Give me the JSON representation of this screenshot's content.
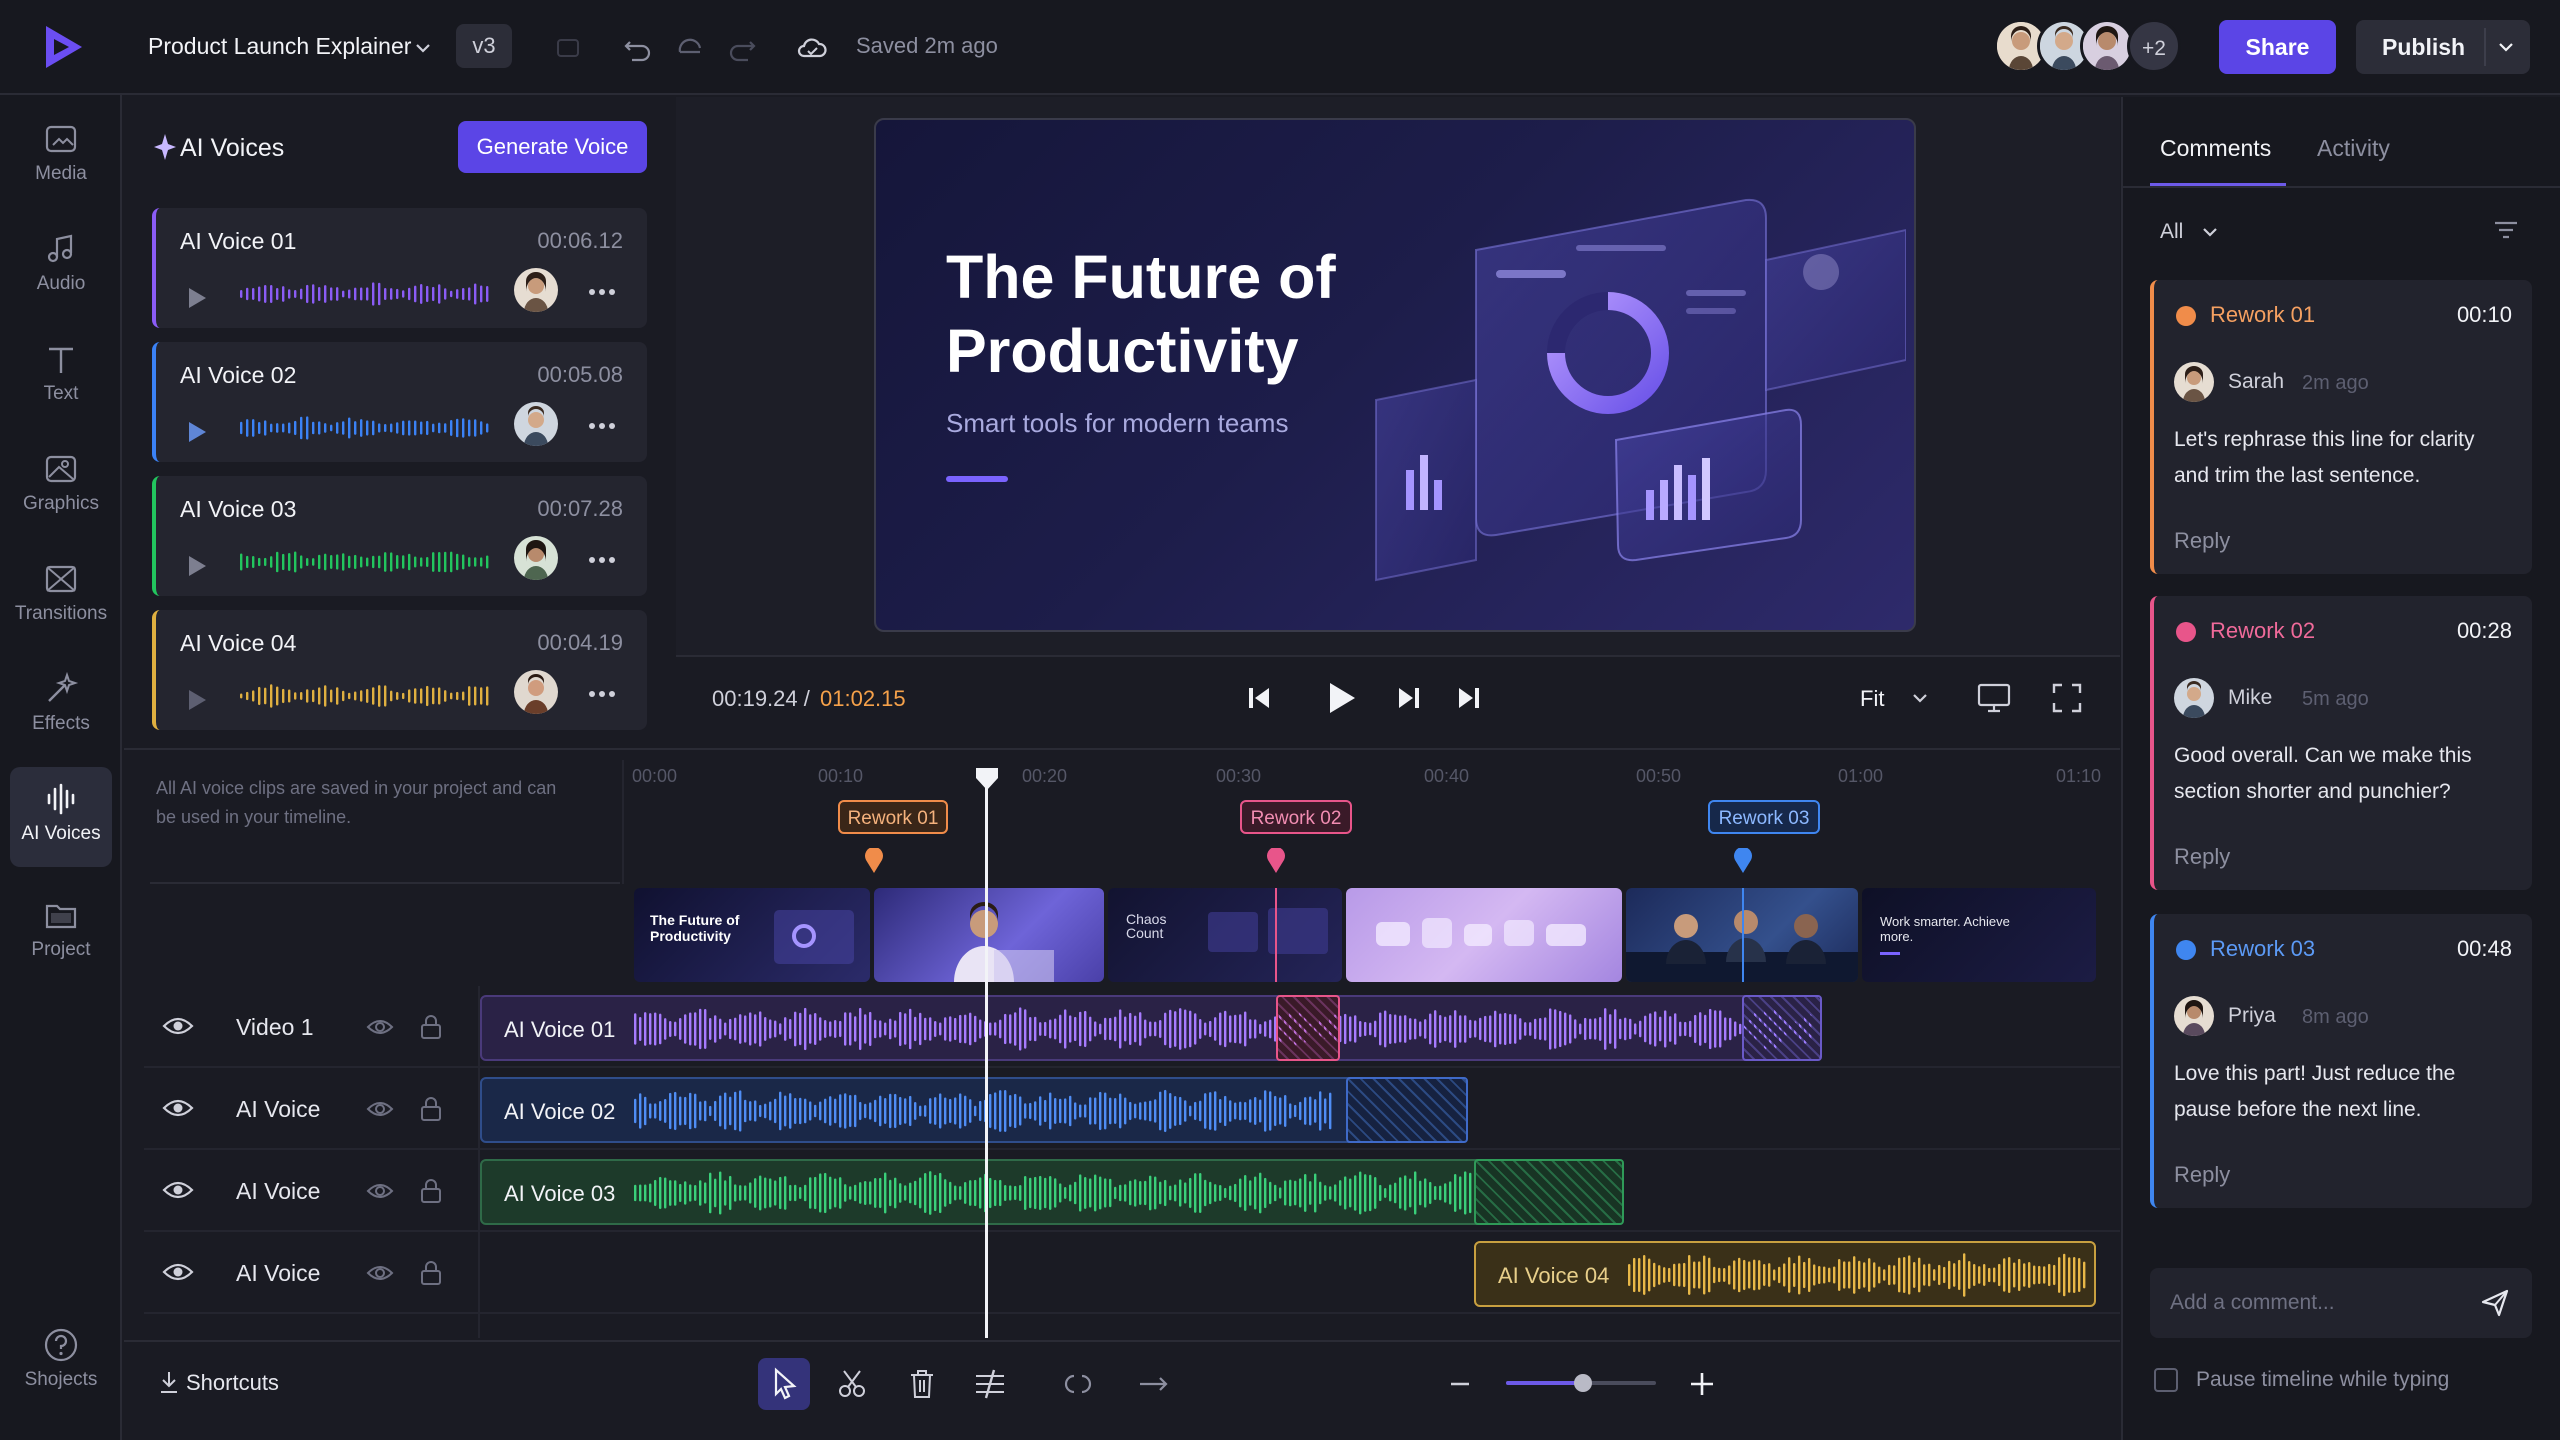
{
  "colors": {
    "accent": "#5b45e6",
    "rework01": "#f08c4a",
    "rework02": "#e8558a",
    "rework03": "#3f86f0",
    "voice01": "#8b5cf6",
    "voice02": "#3b82f6",
    "voice03": "#22c55e",
    "voice04": "#e0b040"
  },
  "topbar": {
    "project_name": "Product Launch Explainer",
    "version": "v3",
    "saved": "Saved 2m ago",
    "collaborators_more": "+2",
    "share": "Share",
    "publish": "Publish"
  },
  "nav": {
    "items": [
      {
        "label": "Media",
        "icon": "media-icon"
      },
      {
        "label": "Audio",
        "icon": "music-note-icon"
      },
      {
        "label": "Text",
        "icon": "text-icon"
      },
      {
        "label": "Graphics",
        "icon": "graphics-icon"
      },
      {
        "label": "Transitions",
        "icon": "transitions-icon"
      },
      {
        "label": "Effects",
        "icon": "effects-icon"
      },
      {
        "label": "AI Voices",
        "icon": "waveform-icon",
        "active": true
      },
      {
        "label": "Project",
        "icon": "folder-icon"
      }
    ],
    "help_label": "Shojects"
  },
  "voices": {
    "title": "AI Voices",
    "generate": "Generate Voice",
    "items": [
      {
        "name": "AI Voice 01",
        "duration": "00:06.12"
      },
      {
        "name": "AI Voice 02",
        "duration": "00:05.08"
      },
      {
        "name": "AI Voice 03",
        "duration": "00:07.28"
      },
      {
        "name": "AI Voice 04",
        "duration": "00:04.19"
      }
    ],
    "note": "All AI voice clips are saved in your project and can be used in your timeline."
  },
  "preview": {
    "title": "The Future of Productivity",
    "subtitle": "Smart tools for modern teams",
    "current_time": "00:19.24",
    "separator": "/",
    "total_time": "01:02.15",
    "fit": "Fit"
  },
  "timeline": {
    "ruler": [
      "00:00",
      "00:10",
      "00:20",
      "00:30",
      "00:40",
      "00:50",
      "01:00",
      "01:10"
    ],
    "markers": [
      "Rework 01",
      "Rework 02",
      "Rework 03"
    ],
    "thumbs": [
      {
        "title": "The Future of Productivity"
      },
      {
        "title": ""
      },
      {
        "title": "Chaos Count"
      },
      {
        "title": ""
      },
      {
        "title": ""
      },
      {
        "title": "Work smarter. Achieve more."
      }
    ],
    "tracks": [
      {
        "name": "Video 1",
        "clip": "AI Voice 01"
      },
      {
        "name": "AI Voice",
        "clip": "AI Voice 02"
      },
      {
        "name": "AI Voice",
        "clip": "AI Voice 03"
      },
      {
        "name": "AI Voice",
        "clip": "AI Voice 04"
      }
    ],
    "playhead_time_s": 17,
    "zoom_level": 0.55
  },
  "bottombar": {
    "shortcuts": "Shortcuts"
  },
  "comments": {
    "tabs": [
      "Comments",
      "Activity"
    ],
    "filter": "All",
    "items": [
      {
        "title": "Rework 01",
        "time": "00:10",
        "user": "Sarah",
        "ago": "2m ago",
        "text": "Let's rephrase this line for clarity and trim the last sentence.",
        "reply": "Reply"
      },
      {
        "title": "Rework 02",
        "time": "00:28",
        "user": "Mike",
        "ago": "5m ago",
        "text": "Good overall. Can we make this section shorter and punchier?",
        "reply": "Reply"
      },
      {
        "title": "Rework 03",
        "time": "00:48",
        "user": "Priya",
        "ago": "8m ago",
        "text": "Love this part! Just reduce the pause before the next line.",
        "reply": "Reply"
      }
    ],
    "input_placeholder": "Add a comment...",
    "pause_label": "Pause timeline while typing"
  }
}
